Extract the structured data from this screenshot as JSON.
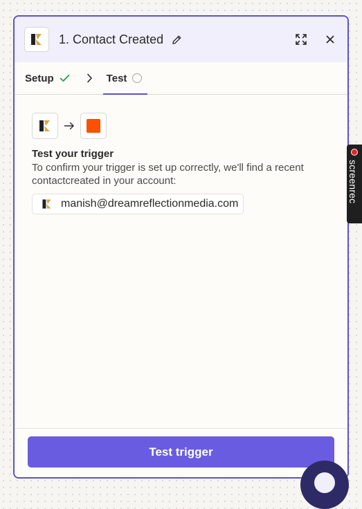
{
  "header": {
    "title": "1. Contact Created",
    "icons": [
      "app-logo-icon",
      "pencil-icon",
      "expand-icon",
      "close-icon"
    ]
  },
  "tabs": [
    {
      "label": "Setup",
      "status": "complete"
    },
    {
      "label": "Test",
      "status": "pending",
      "active": true
    }
  ],
  "content": {
    "flow_icons": [
      "app-logo-icon",
      "arrow-right-icon",
      "orange-square-icon"
    ],
    "section_title": "Test your trigger",
    "section_description": "To confirm your trigger is set up correctly, we'll find a recent contactcreated in your account:",
    "account_email": "manish@dreamreflectionmedia.com"
  },
  "footer": {
    "button_label": "Test trigger"
  },
  "overlay": {
    "screenrec_label": "screenrec"
  },
  "colors": {
    "accent": "#6a5ce0",
    "border": "#5b53c7",
    "header_bg": "#f0effb",
    "check": "#1e9e55",
    "orange": "#ff4f00",
    "logo_gold": "#d8a645",
    "logo_dark": "#222222"
  }
}
